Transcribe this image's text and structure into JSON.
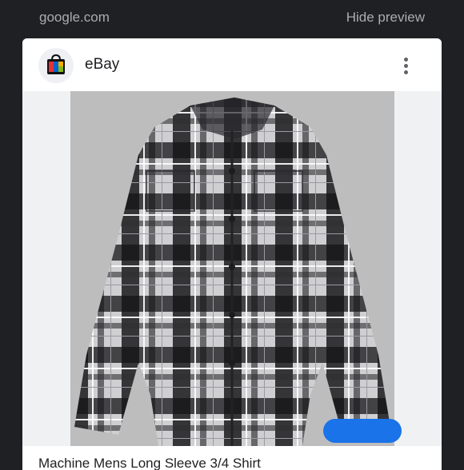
{
  "topbar": {
    "domain": "google.com",
    "hide_preview_label": "Hide preview"
  },
  "card": {
    "site_name": "eBay",
    "caption": "Machine Mens Long Sleeve 3/4 Shirt"
  },
  "colors": {
    "accent": "#1a73e8",
    "background": "#1f2023"
  },
  "icons": {
    "site_logo": "ebay-shopping-bag-icon",
    "menu": "vertical-ellipsis-icon"
  }
}
